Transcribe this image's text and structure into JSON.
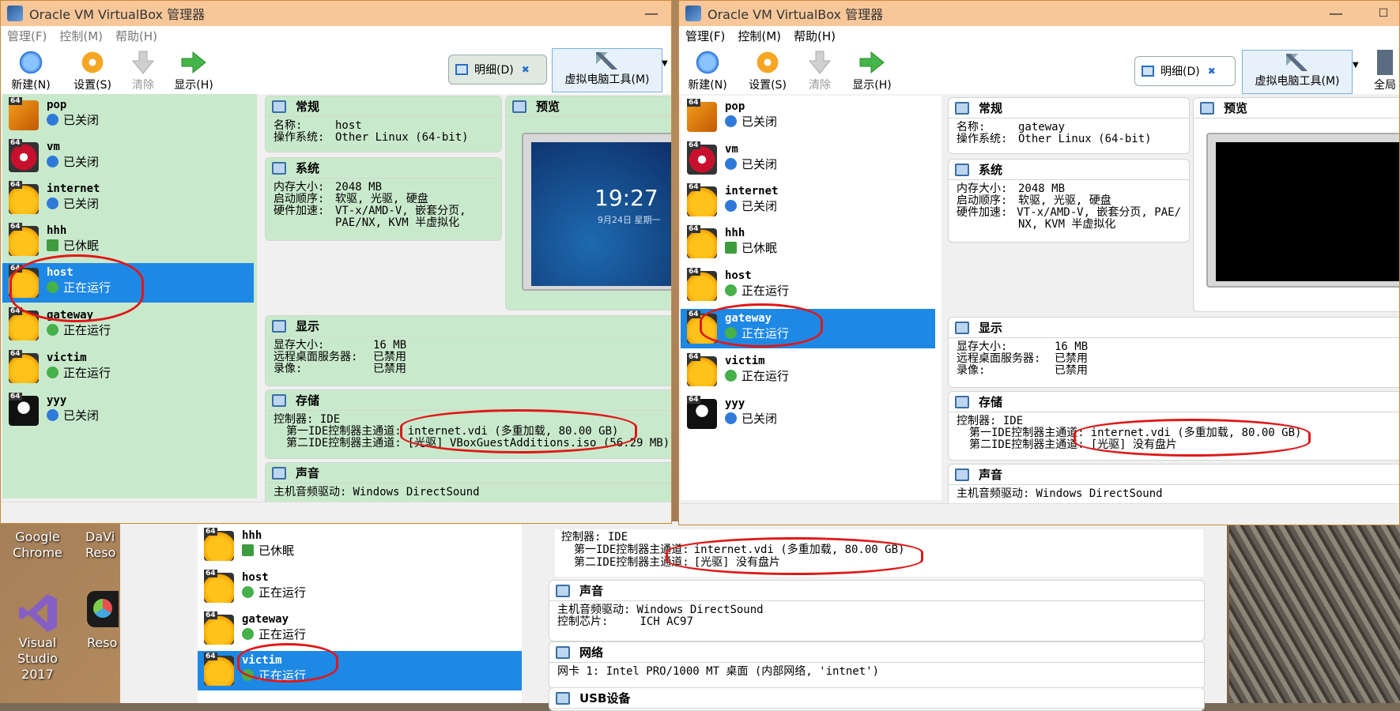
{
  "window_title": "Oracle VM VirtualBox 管理器",
  "menu": [
    "管理(F)",
    "控制(M)",
    "帮助(H)"
  ],
  "toolbar": {
    "new": "新建(N)",
    "settings": "设置(S)",
    "discard": "清除",
    "show": "显示(H)",
    "details": "明细(D)",
    "machine_tools": "虚拟电脑工具(M)",
    "global_tools": "全局"
  },
  "vm_badge": "64",
  "vms_left": [
    {
      "name": "pop",
      "state": "已关闭"
    },
    {
      "name": "vm",
      "state": "已关闭"
    },
    {
      "name": "internet",
      "state": "已关闭"
    },
    {
      "name": "hhh",
      "state": "已休眠"
    },
    {
      "name": "host",
      "state": "正在运行"
    },
    {
      "name": "gateway",
      "state": "正在运行"
    },
    {
      "name": "victim",
      "state": "正在运行"
    },
    {
      "name": "yyy",
      "state": "已关闭"
    }
  ],
  "sections": {
    "general": "常规",
    "preview": "预览",
    "system": "系统",
    "display": "显示",
    "storage": "存储",
    "audio": "声音",
    "network": "网络",
    "usb": "USB设备"
  },
  "labels": {
    "name": "名称:",
    "os": "操作系统:",
    "memory": "内存大小:",
    "boot": "启动顺序:",
    "accel": "硬件加速:",
    "vram": "显存大小:",
    "rdp": "远程桌面服务器:",
    "record": "录像:",
    "controller": "控制器: IDE",
    "ide_primary": "第一IDE控制器主通道:",
    "ide_secondary": "第二IDE控制器主通道:",
    "audio_driver": "主机音频驱动:",
    "audio_chip": "控制芯片:"
  },
  "left": {
    "name": "host",
    "os": "Other Linux (64-bit)",
    "memory": "2048 MB",
    "boot": "软驱, 光驱, 硬盘",
    "accel1": "VT-x/AMD-V, 嵌套分页,",
    "accel2": "PAE/NX, KVM 半虚拟化",
    "vram": "16 MB",
    "rdp": "已禁用",
    "record": "已禁用",
    "disk1": "internet.vdi (多重加载, 80.00 GB)",
    "disk2": "[光驱] VBoxGuestAdditions.iso (56.29 MB)",
    "audio_driver": "Windows DirectSound",
    "preview_time": "19:27",
    "preview_date": "9月24日 星期一"
  },
  "right": {
    "name": "gateway",
    "os": "Other Linux (64-bit)",
    "memory": "2048 MB",
    "boot": "软驱, 光驱, 硬盘",
    "accel1": "VT-x/AMD-V, 嵌套分页, PAE/",
    "accel2": "NX, KVM 半虚拟化",
    "vram": "16 MB",
    "rdp": "已禁用",
    "record": "已禁用",
    "disk1": "internet.vdi (多重加载, 80.00 GB)",
    "disk2": "[光驱] 没有盘片",
    "audio_driver": "Windows DirectSound"
  },
  "bottom": {
    "vms": [
      {
        "name": "hhh",
        "state": "已休眠"
      },
      {
        "name": "host",
        "state": "正在运行"
      },
      {
        "name": "gateway",
        "state": "正在运行"
      },
      {
        "name": "victim",
        "state": "正在运行"
      }
    ],
    "disk1": "internet.vdi (多重加载, 80.00 GB)",
    "disk2": "[光驱] 没有盘片",
    "audio_driver": "Windows DirectSound",
    "audio_chip": "ICH AC97",
    "nic": "网卡 1: Intel PRO/1000 MT 桌面 (内部网络, 'intnet')"
  },
  "desktop": {
    "chrome_1": "Google",
    "chrome_2": "Chrome",
    "vs_1": "Visual",
    "vs_2": "Studio 2017",
    "davinci_1": "DaVi",
    "davinci_2": "Reso",
    "resolve_1": "Reso"
  },
  "colors": {
    "selected": "#1e88e5",
    "title": "#f7c79a",
    "green_panel": "#c9e9cc",
    "annotation": "#e01818"
  }
}
